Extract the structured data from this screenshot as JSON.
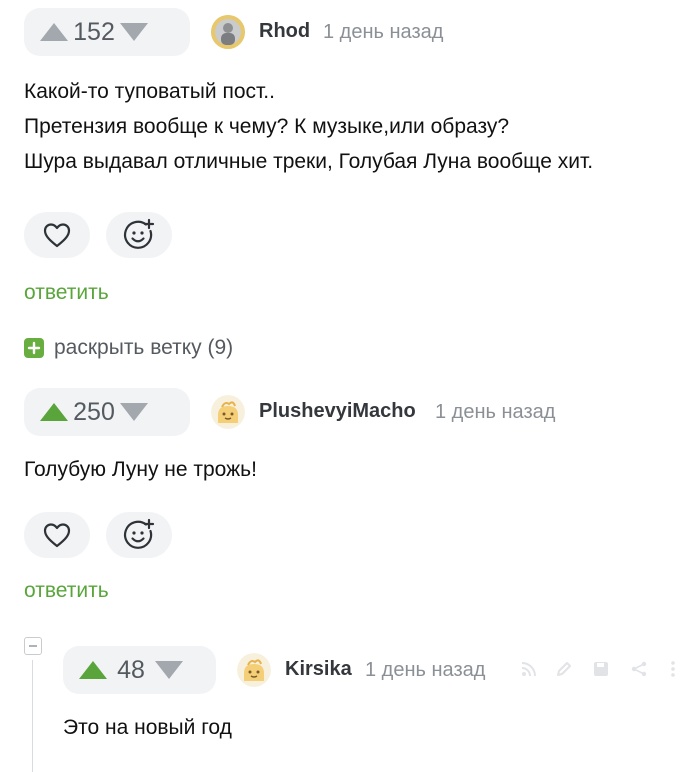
{
  "comments": [
    {
      "votes": "152",
      "author": "Rhod",
      "time": "1 день назад",
      "lines": [
        "Какой-то туповатый пост..",
        "Претензия вообще к чему? К музыке,или образу?",
        "Шура выдавал отличные треки, Голубая Луна вообще хит."
      ],
      "reply_label": "ответить",
      "expand_label": "раскрыть ветку (9)"
    },
    {
      "votes": "250",
      "author": "PlushevyiMacho",
      "time": "1 день назад",
      "lines": [
        "Голубую Луну не трожь!"
      ],
      "reply_label": "ответить"
    },
    {
      "votes": "48",
      "author": "Kirsika",
      "time": "1 день назад",
      "lines": [
        "Это на новый год"
      ]
    }
  ],
  "colors": {
    "accent_green": "#5aa53b",
    "vote_bg": "#f2f3f5",
    "muted_arrow": "#a3a8ae"
  },
  "icons": [
    "arrow-up-icon",
    "arrow-down-icon",
    "heart-icon",
    "add-reaction-icon",
    "expand-plus-icon",
    "collapse-minus-icon",
    "rss-icon",
    "edit-icon",
    "save-icon",
    "share-icon",
    "more-icon"
  ]
}
